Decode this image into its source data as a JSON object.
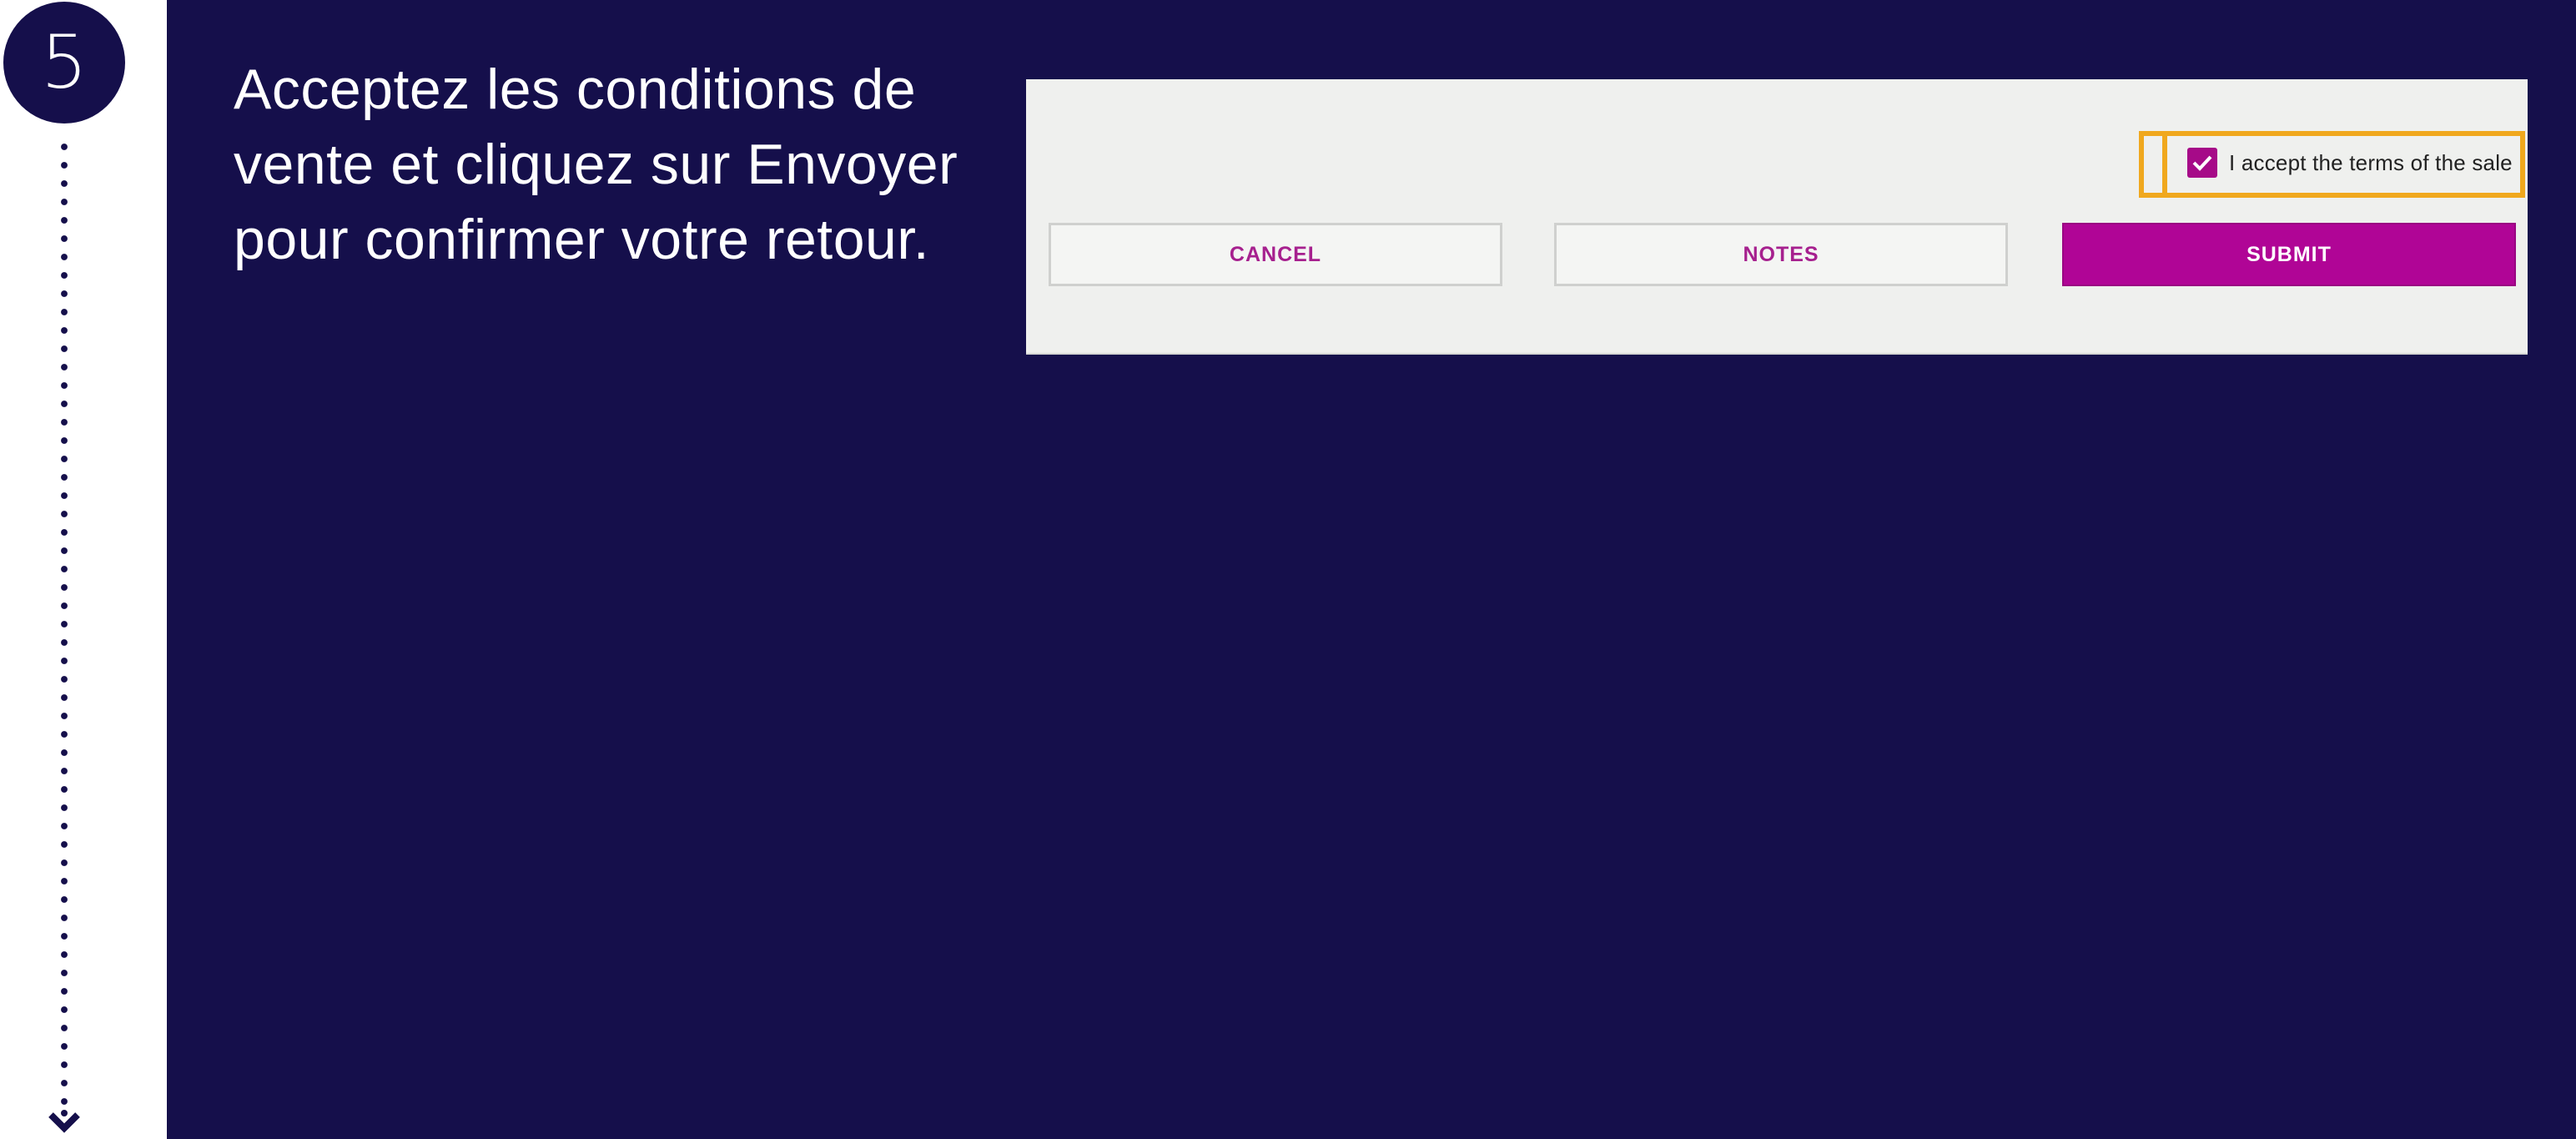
{
  "colors": {
    "navy": "#150f4b",
    "accent_magenta": "#b00596",
    "highlight_orange": "#f0a81e",
    "screenshot_bg": "#eff0ee"
  },
  "step": {
    "number": "5",
    "arrow_icon": "chevron-down-icon"
  },
  "instruction": {
    "text": "Acceptez les conditions de vente et cliquez sur Envoyer pour confirmer votre retour."
  },
  "screenshot": {
    "terms": {
      "checked": true,
      "label": "I accept the terms of the sale",
      "check_icon": "checkmark-icon"
    },
    "buttons": {
      "cancel_label": "CANCEL",
      "notes_label": "NOTES",
      "submit_label": "SUBMIT"
    }
  }
}
